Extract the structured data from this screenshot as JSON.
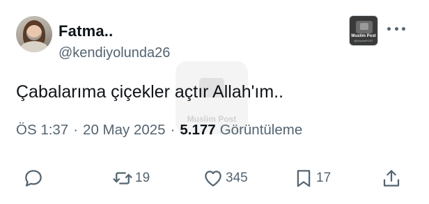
{
  "author": {
    "display_name": "Fatma..",
    "handle": "@kendiyolunda26"
  },
  "badge": {
    "title": "Muslim Post",
    "subtitle": "@MuslimPOST"
  },
  "watermark": {
    "text": "Muslim Post"
  },
  "tweet": {
    "text": "Çabalarıma çiçekler açtır Allah'ım.."
  },
  "meta": {
    "time": "ÖS 1:37",
    "separator": "·",
    "date": "20 May 2025",
    "views_count": "5.177",
    "views_label": "Görüntüleme"
  },
  "actions": {
    "reply_icon": "reply-icon",
    "retweet_count": "19",
    "like_count": "345",
    "bookmark_count": "17",
    "share_icon": "share-icon"
  },
  "colors": {
    "text_primary": "#0f1419",
    "text_secondary": "#536471",
    "background": "#ffffff"
  }
}
